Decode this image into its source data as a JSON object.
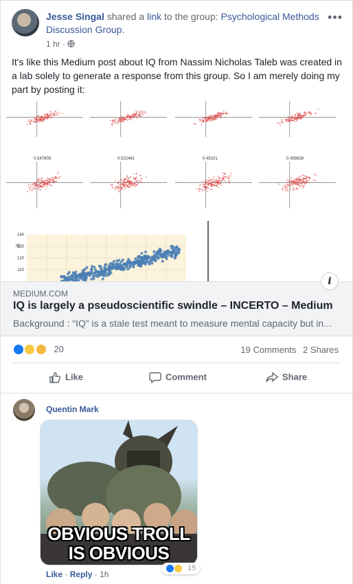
{
  "post": {
    "author": "Jesse Singal",
    "action_text": "shared a",
    "link_word": "link",
    "to_text": "to the group:",
    "group_name": "Psychological Methods Discussion Group.",
    "time": "1 hr",
    "body": "It's like this Medium post about IQ from Nassim Nicholas Taleb was created in a lab solely to generate a response from this group. So I am merely doing my part by posting it:"
  },
  "plots": {
    "row2_labels": [
      "0.547808",
      "0.522461",
      "0.45101",
      "0.459838"
    ],
    "chart_axis_label": "IQ",
    "chart_ticks": [
      "140",
      "130",
      "120",
      "110"
    ]
  },
  "link_preview": {
    "domain": "MEDIUM.COM",
    "title": "IQ is largely a pseudoscientific swindle – INCERTO – Medium",
    "description": "Background : “IQ” is a stale test meant to measure mental capacity but in..."
  },
  "engagement": {
    "reaction_count": "20",
    "comments": "19 Comments",
    "shares": "2 Shares"
  },
  "actions": {
    "like": "Like",
    "comment": "Comment",
    "share": "Share"
  },
  "comment": {
    "author": "Quentin Mark",
    "meme_line1": "OBVIOUS TROLL",
    "meme_line2": "IS OBVIOUS",
    "like": "Like",
    "reply": "Reply",
    "time": "1h",
    "reaction_count": "15"
  },
  "colors": {
    "link_blue": "#385898",
    "like_blue": "#1877f2",
    "scatter_red": "#e05050",
    "scatter_blue": "#4a7fb5"
  }
}
